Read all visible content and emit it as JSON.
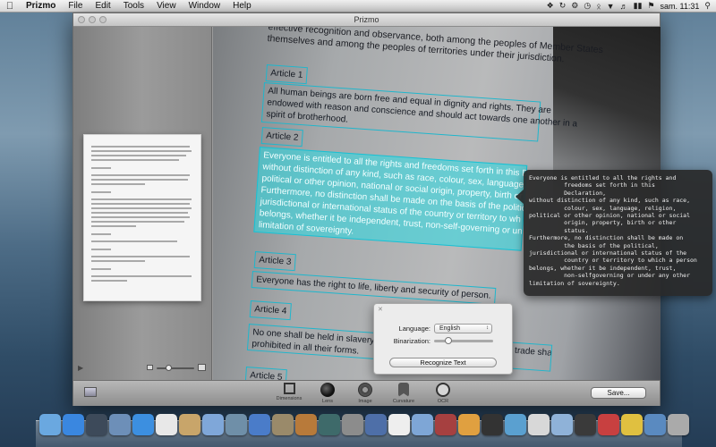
{
  "menubar": {
    "app_name": "Prizmo",
    "menus": [
      "File",
      "Edit",
      "Tools",
      "View",
      "Window",
      "Help"
    ],
    "clock": "sam. 11:31"
  },
  "window": {
    "title": "Prizmo"
  },
  "ocr_regions": [
    {
      "text": "Article 1"
    },
    {
      "text": "All human beings are born free and equal in dignity and rights. They are\nendowed with reason and conscience and should act towards one another in a\nspirit of brotherhood."
    },
    {
      "text": "Article 2"
    },
    {
      "text": "Everyone is entitled to all the rights and freedoms set forth in this Decla\nwithout distinction of any kind, such as race, colour, sex, language, rel\npolitical or other opinion, national or social origin, property, birth or ot\nFurthermore, no distinction shall be made on the basis of the politica\njurisdictional or international status of the country or territory to wh\nbelongs, whether it be independent, trust, non-self-governing or unde\nlimitation of sovereignty."
    },
    {
      "text": "Article 3"
    },
    {
      "text": "Everyone has the right to life, liberty and security of person."
    },
    {
      "text": "Article 4"
    },
    {
      "text": "No one shall be held in slavery or servitude; slavery and the slave trade shall be\nprohibited in all their forms."
    },
    {
      "text": "Article 5"
    }
  ],
  "doc_top_text": "effective recognition and observance, both among the peoples of Member States\nthemselves and among the peoples of territories under their jurisdiction.",
  "tooltip_text": "Everyone is entitled to all the rights and\n          freedoms set forth in this\n          Declaration,\nwithout distinction of any kind, such as race,\n          colour, sex, language, religion,\npolitical or other opinion, national or social\n          origin, property, birth or other\n          status.\nFurthermore, no distinction shall be made on\n          the basis of the political,\njurisdictional or international status of the\n          country or territory to which a person\nbelongs, whether it be independent, trust,\n          non-selfgoverning or under any other\nlimitation of sovereignty.",
  "ocr_panel": {
    "language_label": "Language:",
    "language_value": "English",
    "binarization_label": "Binarization:",
    "binarization_level": 0.2,
    "recognize_label": "Recognize Text"
  },
  "toolbar": {
    "tools": [
      {
        "label": "Dimensions",
        "icon": "crop-icon"
      },
      {
        "label": "Lens",
        "icon": "lens-icon"
      },
      {
        "label": "Image",
        "icon": "gear-icon"
      },
      {
        "label": "Curvature",
        "icon": "curvature-icon"
      },
      {
        "label": "OCR",
        "icon": "ocr-icon"
      }
    ],
    "save_label": "Save..."
  },
  "colors": {
    "selection": "#28dce6",
    "region_border": "#1fb6cc"
  },
  "dock": {
    "icons": [
      "finder-icon",
      "app-store-icon",
      "dashboard-icon",
      "preview-icon",
      "safari-icon",
      "calendar-icon",
      "contacts-icon",
      "mail-icon",
      "iphoto-icon",
      "itunes-icon",
      "grapher-icon",
      "guitar-icon",
      "time-machine-icon",
      "system-prefs-icon",
      "xcode-icon",
      "textedit-icon",
      "folder-icon",
      "photobooth-icon",
      "app-icon",
      "terminal-icon",
      "messages-icon",
      "app-icon",
      "finder-icon",
      "prizmo-icon",
      "unarchiver-icon",
      "magnet-icon",
      "downloads-icon",
      "trash-icon"
    ],
    "colors": [
      "#6aa8e0",
      "#3a87e0",
      "#3d4a5a",
      "#6d8fb8",
      "#3c8fe0",
      "#e8e8e8",
      "#c8a56a",
      "#7fa7d9",
      "#6f8fa8",
      "#4a7cc9",
      "#9a8a6a",
      "#b87a3a",
      "#3e6a6a",
      "#8c8c8c",
      "#4e6fa8",
      "#eeeeee",
      "#7ea6d6",
      "#a64040",
      "#e0a040",
      "#333333",
      "#5aa0d0",
      "#d8d8d8",
      "#8fb2d8",
      "#3a3a3a",
      "#c84040",
      "#e0c040",
      "#5a8ac0",
      "#aaaaaa"
    ]
  }
}
